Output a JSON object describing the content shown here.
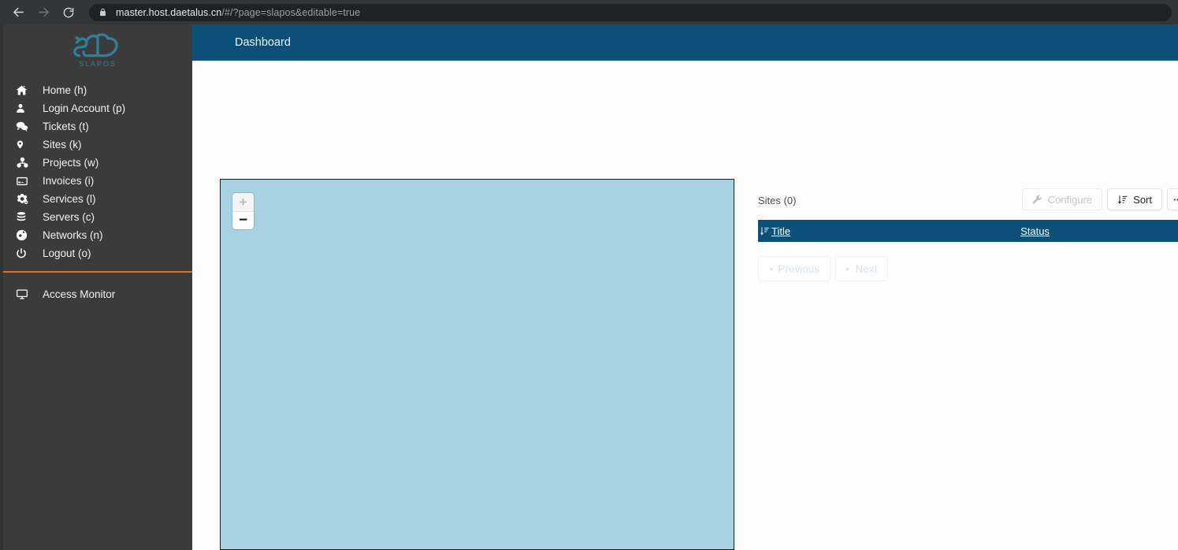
{
  "browser": {
    "back_icon": "back-arrow-icon",
    "forward_icon": "forward-arrow-icon",
    "reload_icon": "reload-icon",
    "lock_icon": "lock-icon",
    "url_domain": "master.host.daetalus.cn",
    "url_path": "/#/?page=slapos&editable=true"
  },
  "sidebar": {
    "logo_text": "SLAPOS",
    "items": [
      {
        "label": "Home (h)",
        "icon": "home-icon"
      },
      {
        "label": "Login Account (p)",
        "icon": "user-icon"
      },
      {
        "label": "Tickets (t)",
        "icon": "comments-icon"
      },
      {
        "label": "Sites (k)",
        "icon": "map-marker-icon"
      },
      {
        "label": "Projects (w)",
        "icon": "sitemap-icon"
      },
      {
        "label": "Invoices (i)",
        "icon": "credit-card-icon"
      },
      {
        "label": "Services (l)",
        "icon": "cogs-icon"
      },
      {
        "label": "Servers (c)",
        "icon": "database-icon"
      },
      {
        "label": "Networks (n)",
        "icon": "globe-icon"
      },
      {
        "label": "Logout (o)",
        "icon": "power-icon"
      }
    ],
    "access_monitor": {
      "label": "Access Monitor",
      "icon": "monitor-icon"
    },
    "divider_color": "#e8701a",
    "background_color": "#3b3b3b"
  },
  "header": {
    "title": "Dashboard",
    "background_color": "#0a5079"
  },
  "map": {
    "zoom_in_label": "+",
    "zoom_out_label": "−",
    "zoom_in_icon": "plus-icon",
    "zoom_out_icon": "minus-icon",
    "fill_color": "#a8d2e2"
  },
  "list": {
    "count_label": "Sites (0)",
    "configure_button": {
      "label": "Configure",
      "icon": "wrench-icon",
      "disabled": true
    },
    "sort_button": {
      "label": "Sort",
      "icon": "sort-icon",
      "disabled": false
    },
    "columns": [
      {
        "label": "Title",
        "icon": "sort-amount-icon"
      },
      {
        "label": "Status",
        "icon": ""
      }
    ],
    "rows": [],
    "pagination": {
      "previous_label": "Previous",
      "next_label": "Next",
      "previous_arrow": "◂",
      "next_arrow": "▸",
      "disabled": true
    }
  }
}
